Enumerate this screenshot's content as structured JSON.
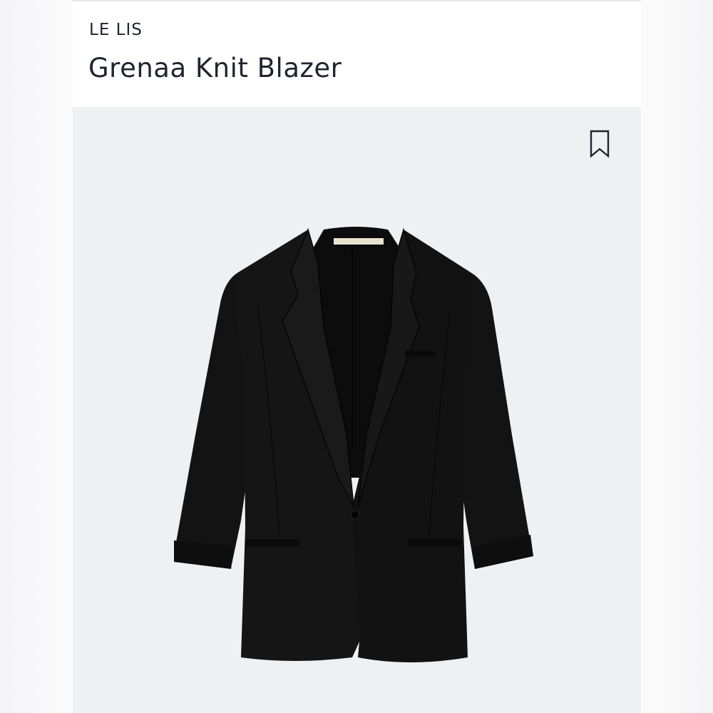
{
  "listing": {
    "brand": "LE LIS",
    "title": "Grenaa Knit Blazer"
  },
  "icons": {
    "bookmark": "bookmark-icon"
  },
  "colors": {
    "text": "#1f2430",
    "panel_bg": "#eff0f2",
    "header_bg": "#ffffff",
    "garment": "#111111"
  }
}
